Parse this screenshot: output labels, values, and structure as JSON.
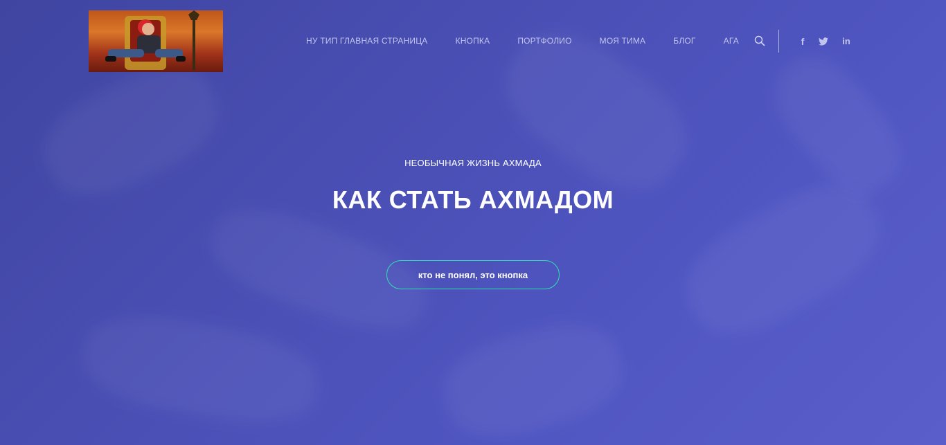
{
  "logo": {
    "icon": "logo-image"
  },
  "nav": {
    "items": [
      {
        "label": "НУ ТИП ГЛАВНАЯ СТРАНИЦА"
      },
      {
        "label": "КНОПКА"
      },
      {
        "label": "ПОРТФОЛИО"
      },
      {
        "label": "МОЯ ТИМА"
      },
      {
        "label": "БЛОГ"
      },
      {
        "label": "АГА"
      }
    ],
    "search_icon": "search-icon"
  },
  "social": {
    "facebook": "f",
    "twitter_icon": "twitter-icon",
    "linkedin": "in"
  },
  "hero": {
    "subtitle": "НЕОБЫЧНАЯ ЖИЗНЬ АХМАДА",
    "title": "КАК СТАТЬ АХМАДОМ",
    "button_label": "кто не понял, это кнопка"
  },
  "colors": {
    "background": "#4a4fb5",
    "nav_text": "#c3c5ee",
    "button_border": "#2fe0b3",
    "text": "#ffffff"
  }
}
